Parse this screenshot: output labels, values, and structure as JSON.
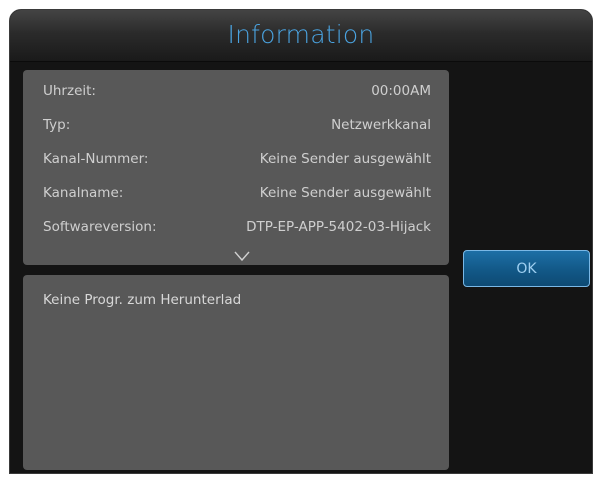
{
  "dialog": {
    "title": "Information"
  },
  "info": {
    "rows": [
      {
        "label": "Uhrzeit:",
        "value": "00:00AM"
      },
      {
        "label": "Typ:",
        "value": "Netzwerkkanal"
      },
      {
        "label": "Kanal-Nummer:",
        "value": "Keine Sender ausgewählt"
      },
      {
        "label": "Kanalname:",
        "value": "Keine Sender ausgewählt"
      },
      {
        "label": "Softwareversion:",
        "value": "DTP-EP-APP-5402-03-Hijack"
      }
    ],
    "scroll_icon": "chevron-down-icon"
  },
  "description": {
    "text": "Keine Progr. zum Herunterlad"
  },
  "buttons": {
    "ok_label": "OK"
  },
  "colors": {
    "title": "#4aa3e0",
    "panel": "#585858",
    "accent": "#125887"
  }
}
